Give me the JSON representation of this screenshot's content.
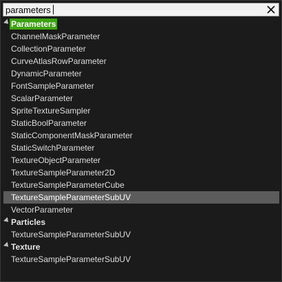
{
  "search": {
    "value": "parameters"
  },
  "categories": [
    {
      "label": "Parameters",
      "highlighted": true,
      "items": [
        "ChannelMaskParameter",
        "CollectionParameter",
        "CurveAtlasRowParameter",
        "DynamicParameter",
        "FontSampleParameter",
        "ScalarParameter",
        "SpriteTextureSampler",
        "StaticBoolParameter",
        "StaticComponentMaskParameter",
        "StaticSwitchParameter",
        "TextureObjectParameter",
        "TextureSampleParameter2D",
        "TextureSampleParameterCube",
        "TextureSampleParameterSubUV",
        "VectorParameter"
      ]
    },
    {
      "label": "Particles",
      "highlighted": false,
      "items": [
        "TextureSampleParameterSubUV"
      ]
    },
    {
      "label": "Texture",
      "highlighted": false,
      "items": [
        "TextureSampleParameterSubUV"
      ]
    }
  ],
  "selected": {
    "category": 0,
    "item": 13
  },
  "colors": {
    "background": "#1b1b1b",
    "highlight": "#3ea313",
    "selection": "#5c5c5c",
    "text": "#dcdcdc"
  },
  "icons": {
    "clear": "close-icon",
    "expand": "expanded-arrow-icon"
  }
}
